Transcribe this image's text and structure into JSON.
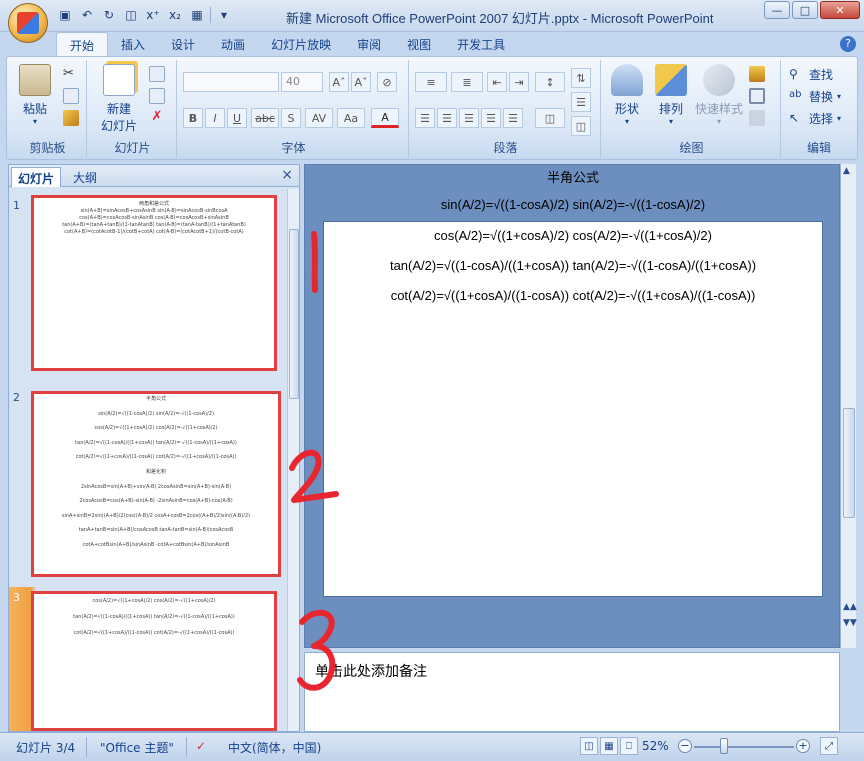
{
  "window": {
    "title": "新建 Microsoft Office PowerPoint 2007 幻灯片.pptx - Microsoft PowerPoint",
    "controls": [
      "minimize",
      "maximize",
      "close"
    ]
  },
  "quick_access": [
    "save-icon",
    "undo-icon",
    "redo-icon",
    "print-preview-icon",
    "superscript-icon",
    "subscript-icon",
    "table-icon",
    "customize-icon"
  ],
  "ribbon_tabs": [
    "开始",
    "插入",
    "设计",
    "动画",
    "幻灯片放映",
    "审阅",
    "视图",
    "开发工具"
  ],
  "active_tab": "开始",
  "ribbon": {
    "clipboard": {
      "label": "剪贴板",
      "paste": "粘贴"
    },
    "slides": {
      "label": "幻灯片",
      "new_slide_line1": "新建",
      "new_slide_line2": "幻灯片"
    },
    "font": {
      "label": "字体",
      "font_name": "",
      "font_size": "40",
      "bold": "B",
      "italic": "I",
      "underline": "U",
      "strike": "abc",
      "shadow": "S",
      "spacing": "AV",
      "case": "Aa",
      "color": "A"
    },
    "paragraph": {
      "label": "段落"
    },
    "drawing": {
      "label": "绘图",
      "shapes": "形状",
      "arrange": "排列",
      "quick_styles": "快速样式"
    },
    "editing": {
      "label": "编辑",
      "find": "查找",
      "replace": "替换",
      "select": "选择"
    }
  },
  "left_pane": {
    "tabs": [
      "幻灯片",
      "大纲"
    ],
    "close": "×",
    "slides": [
      {
        "number": "1",
        "lines": [
          "两角和差公式",
          "sin(A+B)=sinAcosB+cosAsinB  sin(A-B)=sinAcosB-sinBcosA",
          "cos(A+B)=cosAcosB-sinAsinB  cos(A-B)=cosAcosB+sinAsinB",
          "tan(A+B)=(tanA+tanB)/(1-tanAtanB)  tan(A-B)=(tanA-tanB)/(1+tanAtanB)",
          "cot(A+B)=(cotAcotB-1)/(cotB+cotA)  cot(A-B)=(cotAcotB+1)/(cotB-cotA)"
        ]
      },
      {
        "number": "2",
        "lines": [
          "半角公式",
          "sin(A/2)=√((1-cosA)/2)  sin(A/2)=-√((1-cosA)/2)",
          "cos(A/2)=√((1+cosA)/2)  cos(A/2)=-√((1+cosA)/2)",
          "tan(A/2)=√((1-cosA)/((1+cosA))  tan(A/2)=-√((1-cosA)/((1+cosA))",
          "cot(A/2)=√((1+cosA)/((1-cosA))  cot(A/2)=-√((1+cosA)/((1-cosA))",
          "和差化积",
          "2sinAcosB=sin(A+B)+sin(A-B)  2cosAsinB=sin(A+B)-sin(A-B)",
          "2cosAcosB=cos(A+B)-sin(A-B)  -2sinAsinB=cos(A+B)-cos(A-B)",
          "sinA+sinB=2sin((A+B)/2)cos((A-B)/2  cosA+cosB=2cos((A+B)/2)sin((A-B)/2)",
          "tanA+tanB=sin(A+B)/cosAcosB  tanA-tanB=sin(A-B)/cosAcosB",
          "cotA+cotBsin(A+B)/sinAsinB  -cotA+cotBsin(A+B)/sinAsinB"
        ]
      },
      {
        "number": "3",
        "lines": [
          "cos(A/2)=√((1+cosA)/2)  cos(A/2)=-√((1+cosA)/2)",
          "tan(A/2)=√((1-cosA)/((1+cosA))  tan(A/2)=-√((1-cosA)/((1+cosA))",
          "cot(A/2)=√((1+cosA)/((1-cosA))  cot(A/2)=-√((1+cosA)/((1-cosA))"
        ]
      }
    ],
    "selected_slide": "3"
  },
  "main_slide": {
    "above_lines": [
      "半角公式",
      "sin(A/2)=√((1-cosA)/2) sin(A/2)=-√((1-cosA)/2)"
    ],
    "lines": [
      "cos(A/2)=√((1+cosA)/2) cos(A/2)=-√((1+cosA)/2)",
      "tan(A/2)=√((1-cosA)/((1+cosA)) tan(A/2)=-√((1-cosA)/((1+cosA))",
      "cot(A/2)=√((1+cosA)/((1-cosA)) cot(A/2)=-√((1+cosA)/((1-cosA))"
    ]
  },
  "notes": {
    "placeholder": "单击此处添加备注"
  },
  "status": {
    "slide_counter": "幻灯片 3/4",
    "theme": "\"Office 主题\"",
    "language": "中文(简体，中国)",
    "zoom": "52%",
    "zoom_fraction": 0.52
  },
  "annotations": {
    "handwritten": [
      "1",
      "2",
      "3"
    ],
    "color": "#e8262f"
  },
  "colors": {
    "ribbon_bg": "#dbe7f6",
    "selection_orange": "#f0a042",
    "thumb_border": "#e04040",
    "slide_area": "#6d8fc0"
  }
}
